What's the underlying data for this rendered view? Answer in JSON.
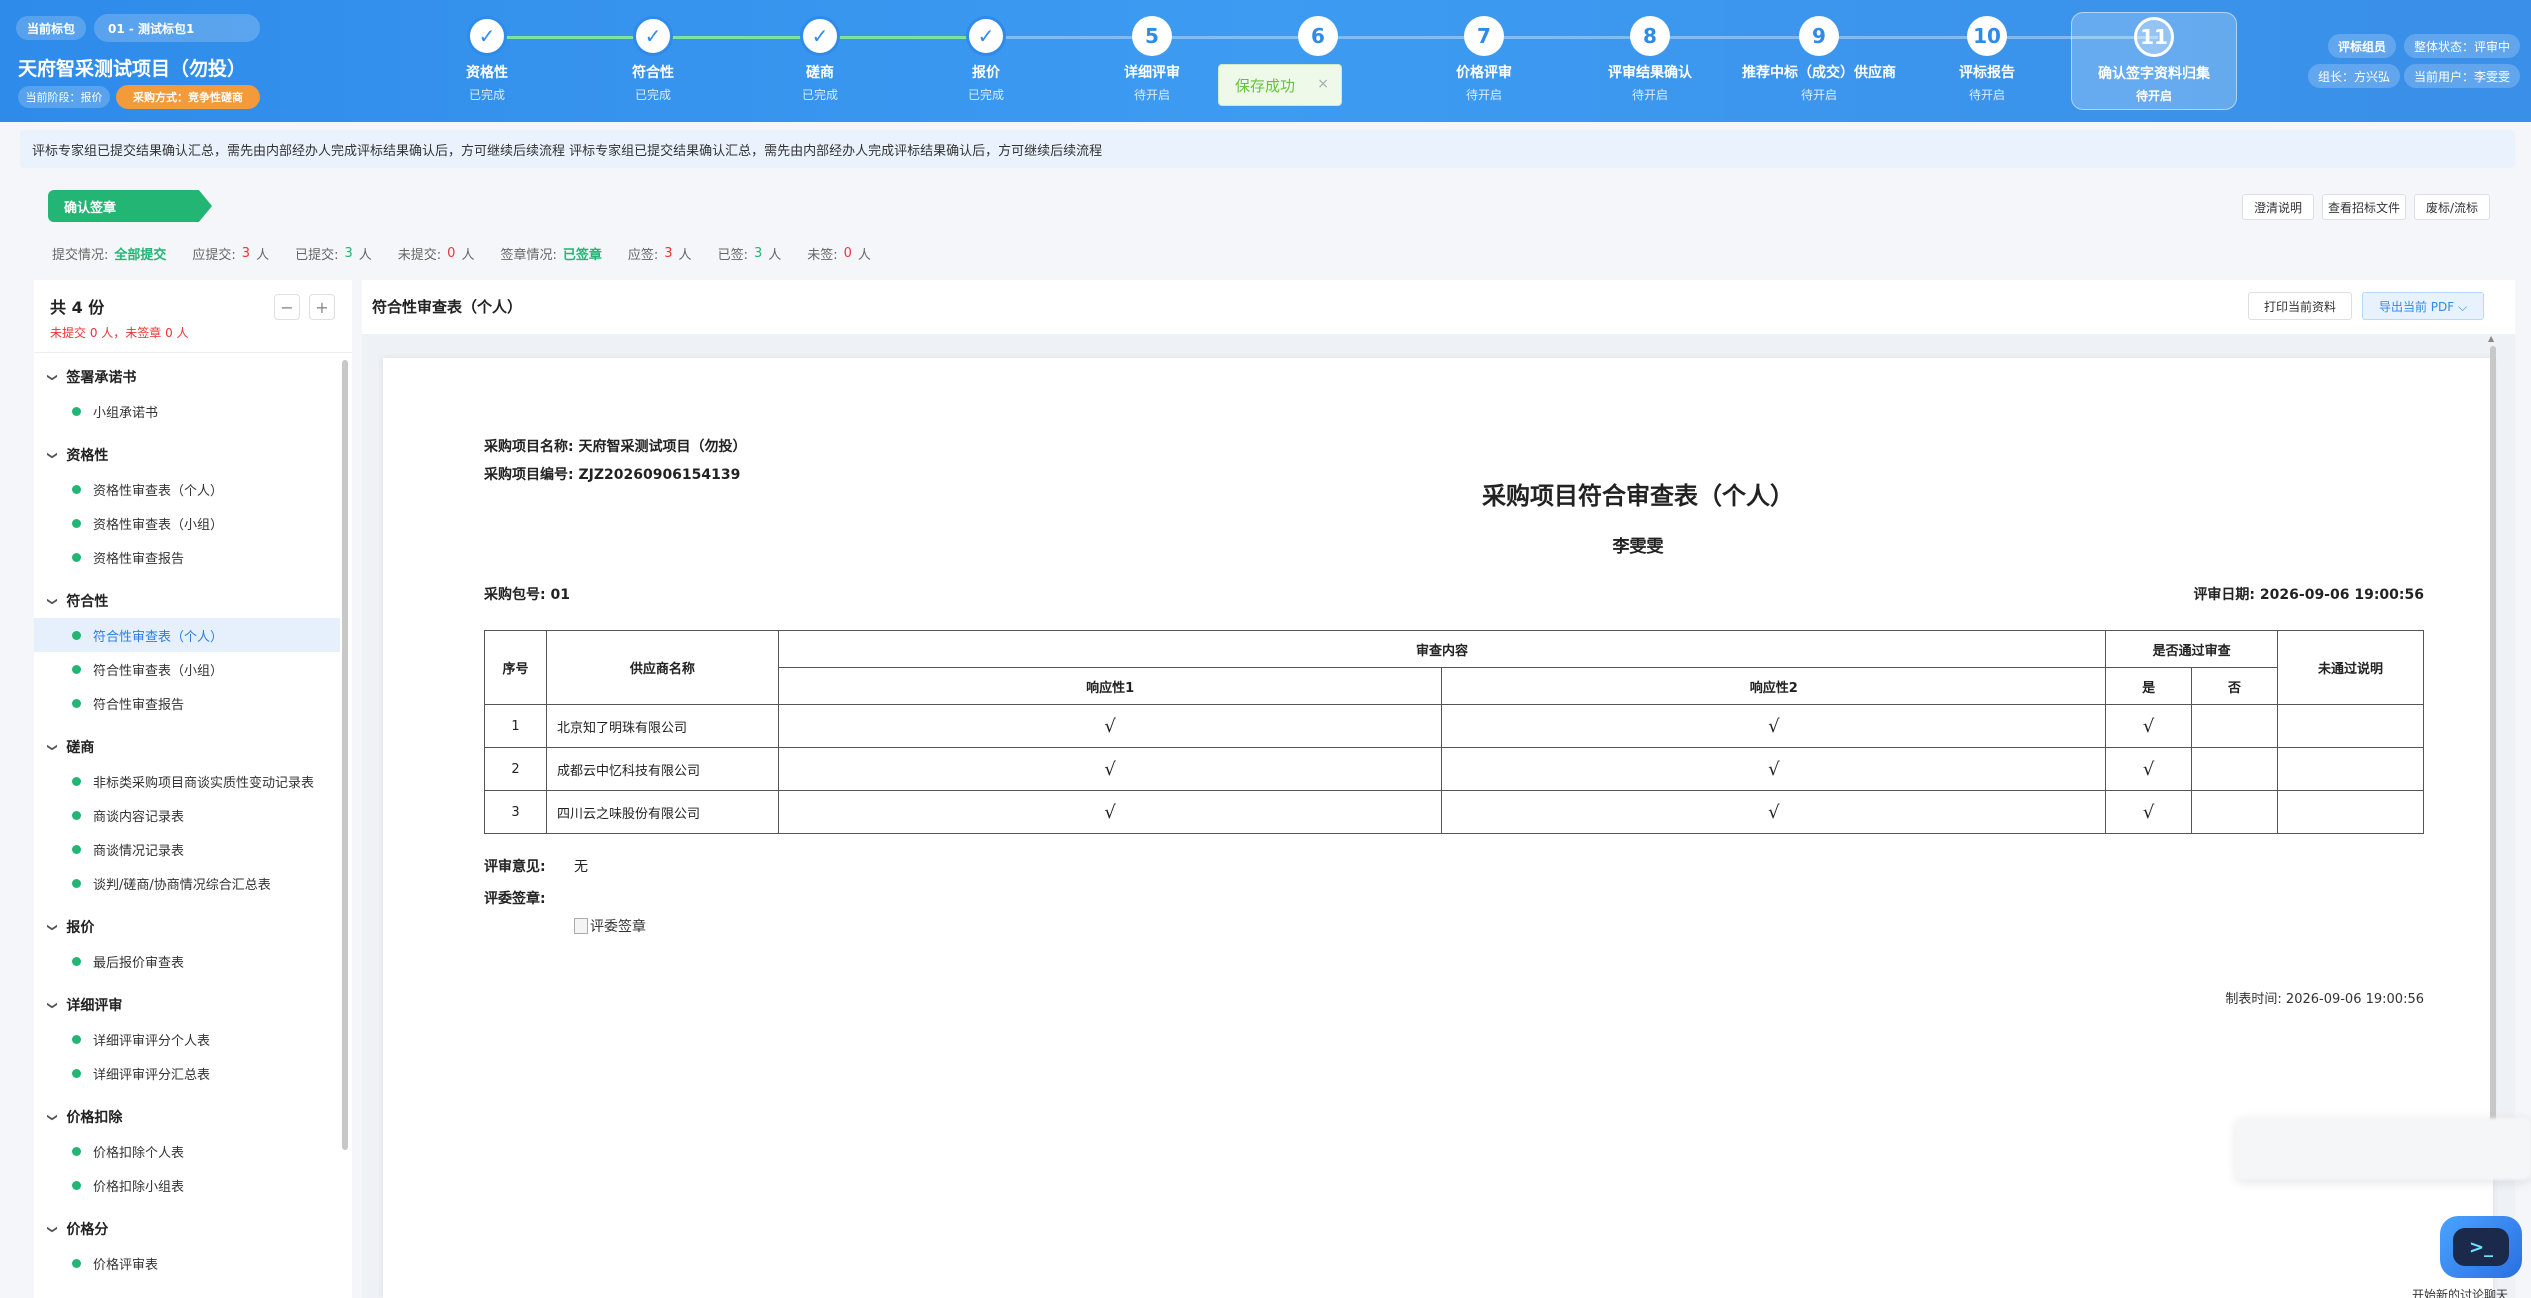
{
  "header": {
    "current_pkg_label": "当前标包",
    "current_pkg_value": "01 - 测试标包1",
    "project_title": "天府智采测试项目（勿投）",
    "stage": "当前阶段：报价",
    "method": "采购方式：竞争性磋商",
    "steps": [
      {
        "num": "✓",
        "label": "资格性",
        "status": "已完成"
      },
      {
        "num": "✓",
        "label": "符合性",
        "status": "已完成"
      },
      {
        "num": "✓",
        "label": "磋商",
        "status": "已完成"
      },
      {
        "num": "✓",
        "label": "报价",
        "status": "已完成"
      },
      {
        "num": "5",
        "label": "详细评审",
        "status": "待开启"
      },
      {
        "num": "6",
        "label": "",
        "status": ""
      },
      {
        "num": "7",
        "label": "价格评审",
        "status": "待开启"
      },
      {
        "num": "8",
        "label": "评审结果确认",
        "status": "待开启"
      },
      {
        "num": "9",
        "label": "推荐中标（成交）供应商",
        "status": "待开启"
      },
      {
        "num": "10",
        "label": "评标报告",
        "status": "待开启"
      },
      {
        "num": "11",
        "label": "确认签字资料归集",
        "status": "待开启"
      }
    ],
    "role": "评标组员",
    "overall_status": "整体状态：评审中",
    "leader": "组长：方兴弘",
    "current_user": "当前用户：李雯雯"
  },
  "toast": {
    "text": "保存成功",
    "close": "×"
  },
  "notice": "评标专家组已提交结果确认汇总，需先由内部经办人完成评标结果确认后，方可继续后续流程 评标专家组已提交结果确认汇总，需先由内部经办人完成评标结果确认后，方可继续后续流程",
  "ribbon": "确认签章",
  "top_buttons": [
    "澄清说明",
    "查看招标文件",
    "废标/流标"
  ],
  "stats": {
    "submit_label": "提交情况:",
    "submit_status": "全部提交",
    "should_submit_label": "应提交:",
    "should_submit": "3",
    "submitted_label": "已提交:",
    "submitted": "3",
    "not_submitted_label": "未提交:",
    "not_submitted": "0",
    "sign_label": "签章情况:",
    "sign_status": "已签章",
    "should_sign_label": "应签:",
    "should_sign": "3",
    "signed_label": "已签:",
    "signed": "3",
    "not_signed_label": "未签:",
    "not_signed": "0",
    "unit": "人"
  },
  "sidebar": {
    "title": "共 4 份",
    "subtitle": "未提交 0 人，未签章 0 人",
    "collapse": "−",
    "expand": "+",
    "groups": [
      {
        "name": "签署承诺书",
        "items": [
          "小组承诺书"
        ]
      },
      {
        "name": "资格性",
        "items": [
          "资格性审查表（个人）",
          "资格性审查表（小组）",
          "资格性审查报告"
        ]
      },
      {
        "name": "符合性",
        "items": [
          "符合性审查表（个人）",
          "符合性审查表（小组）",
          "符合性审查报告"
        ]
      },
      {
        "name": "磋商",
        "items": [
          "非标类采购项目商谈实质性变动记录表",
          "商谈内容记录表",
          "商谈情况记录表",
          "谈判/磋商/协商情况综合汇总表"
        ]
      },
      {
        "name": "报价",
        "items": [
          "最后报价审查表"
        ]
      },
      {
        "name": "详细评审",
        "items": [
          "详细评审评分个人表",
          "详细评审评分汇总表"
        ]
      },
      {
        "name": "价格扣除",
        "items": [
          "价格扣除个人表",
          "价格扣除小组表"
        ]
      },
      {
        "name": "价格分",
        "items": [
          "价格评审表"
        ]
      }
    ]
  },
  "main": {
    "title": "符合性审查表（个人）",
    "print_btn": "打印当前资料",
    "export_btn": "导出当前 PDF ⌵"
  },
  "doc": {
    "project_name_label": "采购项目名称:",
    "project_name": "天府智采测试项目（勿投）",
    "project_no_label": "采购项目编号:",
    "project_no": "ZJZ20260906154139",
    "title": "采购项目符合审查表（个人）",
    "reviewer": "李雯雯",
    "pkg_label": "采购包号:",
    "pkg_no": "01",
    "date_label": "评审日期:",
    "date": "2026-09-06 19:00:56",
    "headers": {
      "seq": "序号",
      "supplier": "供应商名称",
      "content": "审查内容",
      "resp1": "响应性1",
      "resp2": "响应性2",
      "pass": "是否通过审查",
      "yes": "是",
      "no": "否",
      "fail_note": "未通过说明"
    },
    "rows": [
      {
        "seq": "1",
        "supplier": "北京知了明珠有限公司",
        "r1": "√",
        "r2": "√",
        "yes": "√",
        "no": "",
        "note": ""
      },
      {
        "seq": "2",
        "supplier": "成都云中忆科技有限公司",
        "r1": "√",
        "r2": "√",
        "yes": "√",
        "no": "",
        "note": ""
      },
      {
        "seq": "3",
        "supplier": "四川云之味股份有限公司",
        "r1": "√",
        "r2": "√",
        "yes": "√",
        "no": "",
        "note": ""
      }
    ],
    "opinion_label": "评审意见:",
    "opinion": "无",
    "sign_label": "评委签章:",
    "sign_img_alt": "评委签章",
    "made_time_label": "制表时间:",
    "made_time": "2026-09-06 19:00:56"
  },
  "assistant": {
    "text": "开始新的讨论聊天"
  }
}
